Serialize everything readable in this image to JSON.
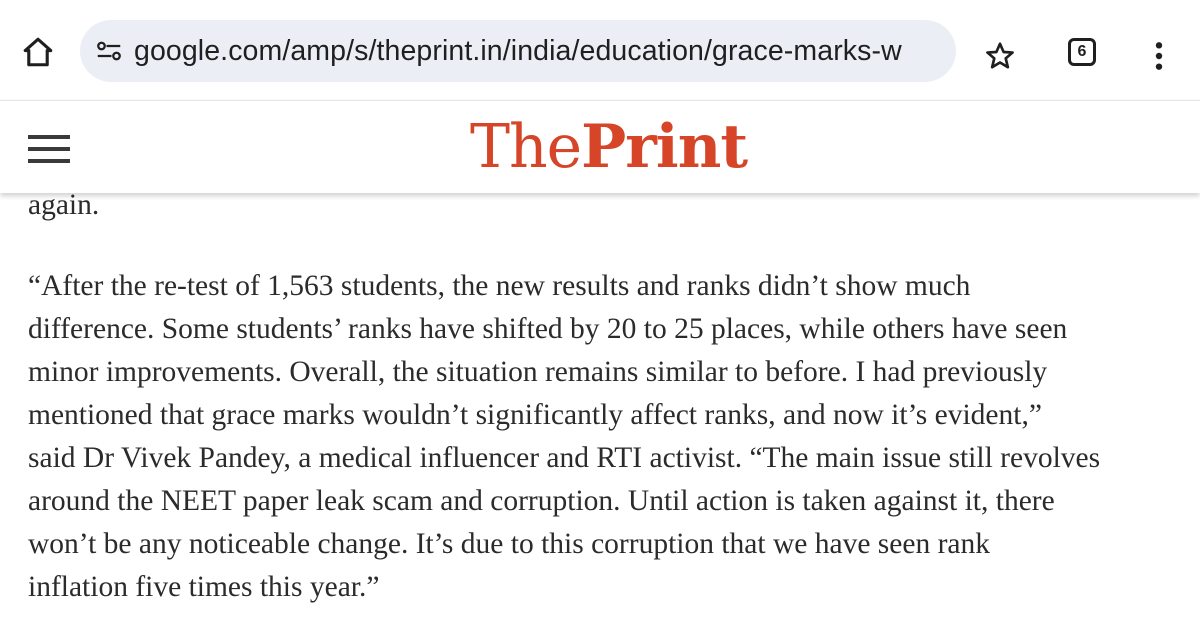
{
  "browser": {
    "url": "google.com/amp/s/theprint.in/india/education/grace-marks-w",
    "tab_count": "6",
    "icons": {
      "home": "home-icon",
      "site_info": "tune-icon",
      "bookmark": "star-icon",
      "tabs": "tab-switcher-icon",
      "menu": "more-vert-icon"
    }
  },
  "site": {
    "logo_part1": "The",
    "logo_part2": "Print",
    "brand_color": "#d64527",
    "menu_icon": "hamburger-icon"
  },
  "article": {
    "prev_paragraph_tail": "again.",
    "lines": [
      "“After the re-test of 1,563 students, the new results and ranks didn’t show much",
      "difference. Some students’ ranks have shifted by 20 to 25 places, while others have seen",
      "minor improvements. Overall, the situation remains similar to before. I had previously",
      "mentioned that grace marks wouldn’t significantly affect ranks, and now it’s evident,”",
      "said Dr Vivek Pandey, a medical influencer and RTI activist. “The main issue still revolves",
      "around the NEET paper leak scam and corruption. Until action is taken against it, there",
      "won’t be any noticeable change. It’s due to this corruption that we have seen rank",
      "inflation five times this year.”"
    ]
  }
}
